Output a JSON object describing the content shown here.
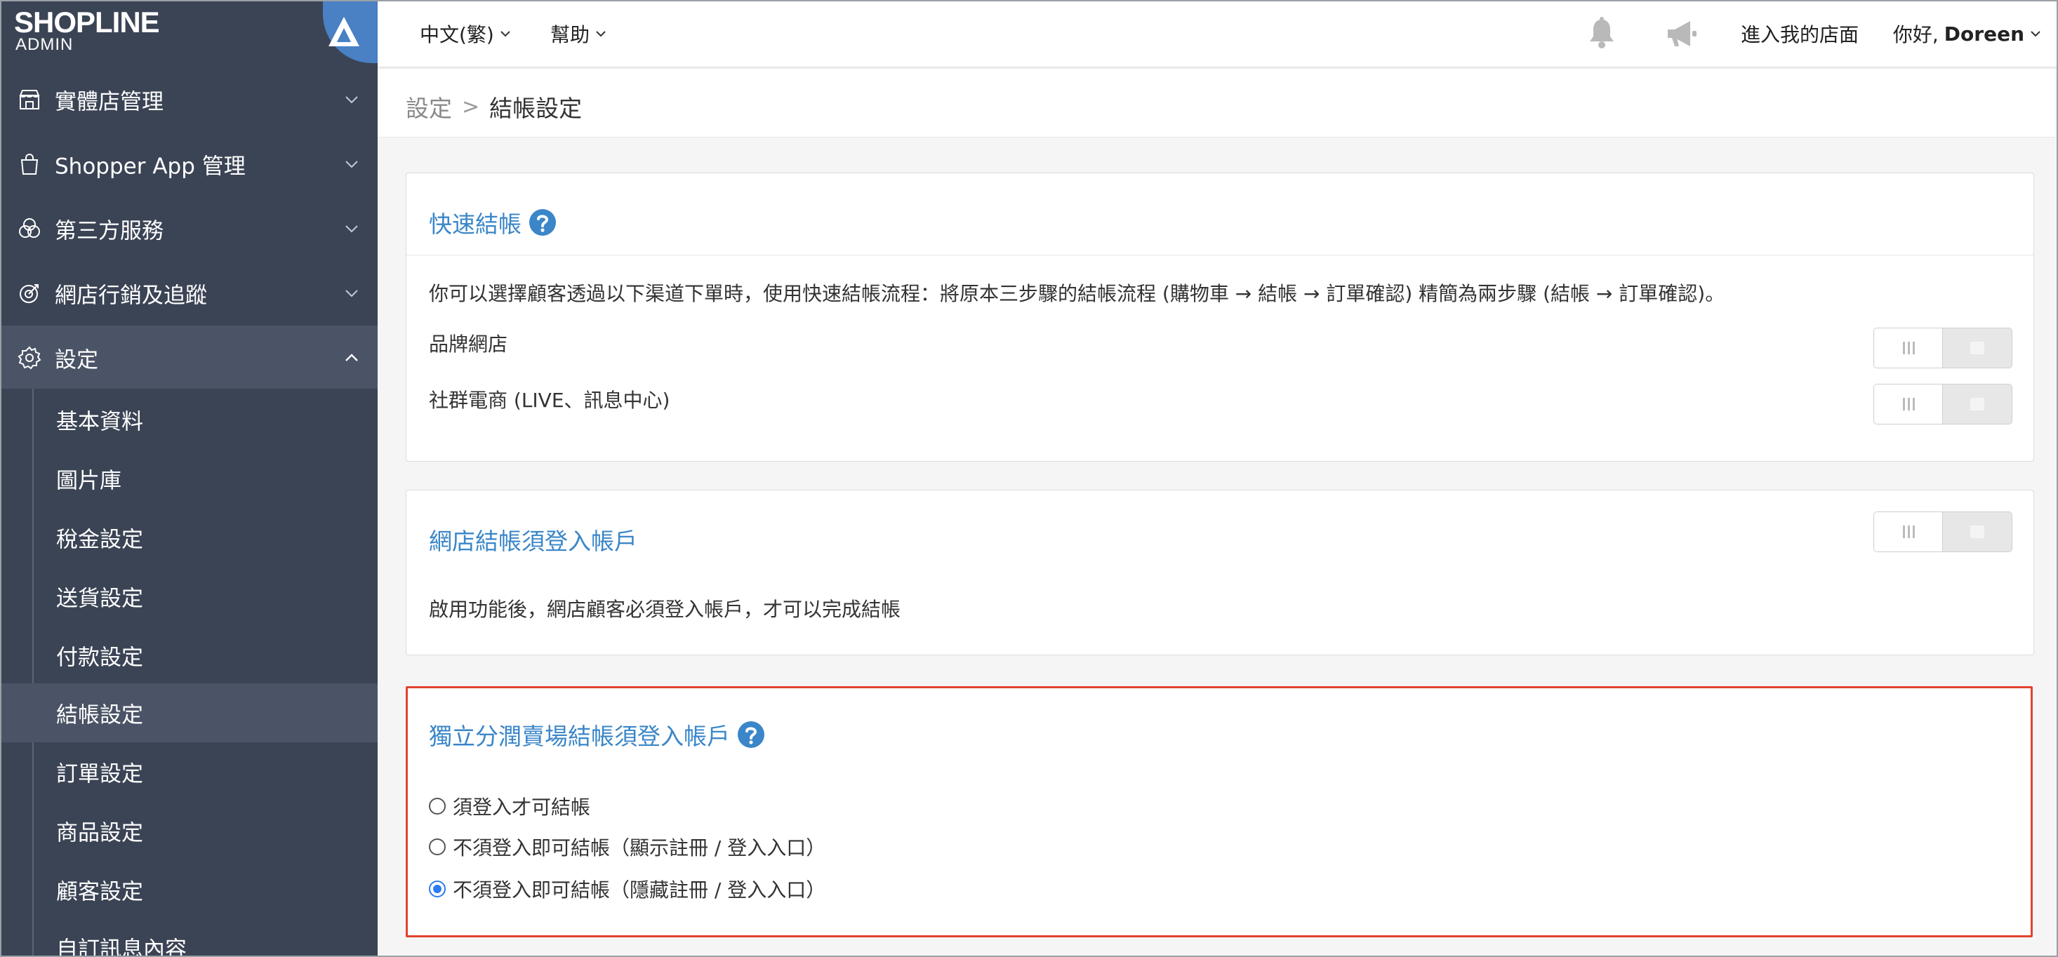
{
  "brand": {
    "logo_text": "SHOPLINE",
    "sub_text": "ADMIN"
  },
  "sidebar": {
    "items": [
      {
        "label": "實體店管理",
        "icon": "store-icon"
      },
      {
        "label": "Shopper App 管理",
        "icon": "shopping-bag-icon"
      },
      {
        "label": "第三方服務",
        "icon": "circles-icon"
      },
      {
        "label": "網店行銷及追蹤",
        "icon": "target-icon"
      },
      {
        "label": "設定",
        "icon": "gear-icon",
        "expanded": true
      }
    ],
    "subitems": [
      {
        "label": "基本資料"
      },
      {
        "label": "圖片庫"
      },
      {
        "label": "稅金設定"
      },
      {
        "label": "送貨設定"
      },
      {
        "label": "付款設定"
      },
      {
        "label": "結帳設定",
        "active": true
      },
      {
        "label": "訂單設定"
      },
      {
        "label": "商品設定"
      },
      {
        "label": "顧客設定"
      },
      {
        "label": "自訂訊息內容"
      }
    ]
  },
  "topbar": {
    "language": "中文(繁)",
    "help": "幫助",
    "visit_store": "進入我的店面",
    "greeting_prefix": "你好, ",
    "user_name": "Doreen"
  },
  "breadcrumb": {
    "parent": "設定",
    "separator": ">",
    "current": "結帳設定"
  },
  "quick_checkout": {
    "title": "快速結帳",
    "description": "你可以選擇顧客透過以下渠道下單時，使用快速結帳流程：將原本三步驟的結帳流程 (購物車 → 結帳 → 訂單確認) 精簡為兩步驟 (結帳 → 訂單確認)。",
    "rows": [
      {
        "label": "品牌網店",
        "enabled": false
      },
      {
        "label": "社群電商 (LIVE、訊息中心)",
        "enabled": false
      }
    ]
  },
  "login_required": {
    "title": "網店結帳須登入帳戶",
    "description": "啟用功能後，網店顧客必須登入帳戶，才可以完成結帳",
    "enabled": false
  },
  "affiliate_login": {
    "title": "獨立分潤賣場結帳須登入帳戶",
    "options": [
      {
        "label": "須登入才可結帳",
        "checked": false
      },
      {
        "label": "不須登入即可結帳（顯示註冊 / 登入入口）",
        "checked": false
      },
      {
        "label": "不須登入即可結帳（隱藏註冊 / 登入入口）",
        "checked": true
      }
    ]
  },
  "colors": {
    "sidebar_bg": "#3b4455",
    "accent_blue": "#3a86c8",
    "highlight_red": "#e0442f",
    "radio_blue": "#2e7bf0"
  }
}
